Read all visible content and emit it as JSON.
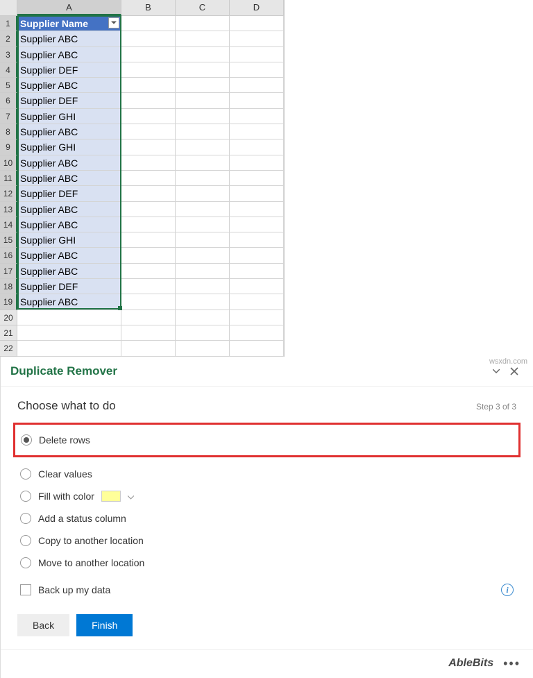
{
  "columns": [
    "A",
    "B",
    "C",
    "D"
  ],
  "header_cell": "Supplier Name",
  "rows": [
    "Supplier ABC",
    "Supplier ABC",
    "Supplier DEF",
    "Supplier ABC",
    "Supplier DEF",
    "Supplier GHI",
    "Supplier ABC",
    "Supplier GHI",
    "Supplier ABC",
    "Supplier ABC",
    "Supplier DEF",
    "Supplier ABC",
    "Supplier ABC",
    "Supplier GHI",
    "Supplier ABC",
    "Supplier ABC",
    "Supplier DEF",
    "Supplier ABC"
  ],
  "empty_rows": [
    20,
    21,
    22
  ],
  "pane": {
    "title": "Duplicate Remover",
    "step_title": "Choose what to do",
    "step_n": "Step 3 of 3",
    "options": {
      "delete": "Delete rows",
      "clear": "Clear values",
      "fill": "Fill with color",
      "status": "Add a status column",
      "copy": "Copy to another location",
      "move": "Move to another location"
    },
    "backup": "Back up my data",
    "back": "Back",
    "finish": "Finish",
    "brand": "AbleBits"
  },
  "watermark": "wsxdn.com"
}
